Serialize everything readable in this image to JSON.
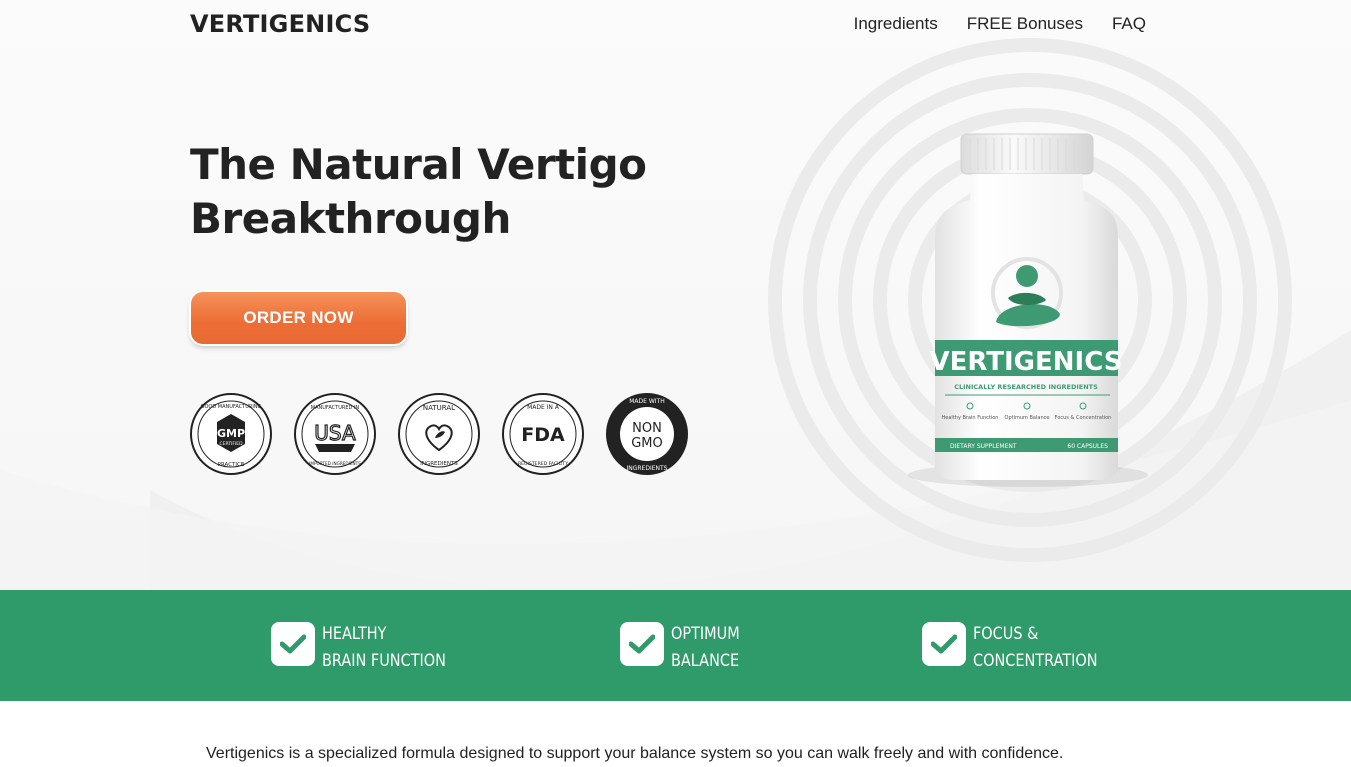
{
  "header": {
    "logo": "VERTIGENICS",
    "nav": [
      "Ingredients",
      "FREE Bonuses",
      "FAQ"
    ]
  },
  "hero": {
    "headline_line1": "The Natural Vertigo",
    "headline_line2": "Breakthrough",
    "cta_label": "ORDER NOW",
    "badges": [
      {
        "name": "gmp-badge",
        "top": "GOOD MANUFACTURING",
        "center": "GMP",
        "sub": "CERTIFIED",
        "bottom": "PRACTICE"
      },
      {
        "name": "usa-badge",
        "top": "MANUFACTURED IN",
        "center": "USA",
        "bottom": "IMPORTED INGREDIENTS"
      },
      {
        "name": "natural-badge",
        "top": "NATURAL",
        "bottom": "INGREDIENTS"
      },
      {
        "name": "fda-badge",
        "top": "MADE IN A",
        "center": "FDA",
        "bottom": "REGISTERED FACILITY"
      },
      {
        "name": "non-gmo-badge",
        "top": "MADE WITH",
        "center1": "NON",
        "center2": "GMO",
        "bottom": "INGREDIENTS"
      }
    ],
    "product": {
      "brand": "VERTIGENICS",
      "tagline": "CLINICALLY RESEARCHED INGREDIENTS",
      "benefits": [
        "Healthy Brain Function",
        "Optimum Balance",
        "Focus & Concentration"
      ],
      "footer_left": "DIETARY SUPPLEMENT",
      "footer_right": "60 CAPSULES"
    }
  },
  "benefits": [
    {
      "line1": "HEALTHY",
      "line2": "BRAIN FUNCTION"
    },
    {
      "line1": "OPTIMUM",
      "line2": "BALANCE"
    },
    {
      "line1": "FOCUS &",
      "line2": "CONCENTRATION"
    }
  ],
  "intro": "Vertigenics is a specialized formula designed to support your balance system so you can walk freely and with confidence.",
  "colors": {
    "accent_green": "#2f9a6a",
    "cta_orange": "#ec6d35",
    "text_dark": "#222222"
  }
}
